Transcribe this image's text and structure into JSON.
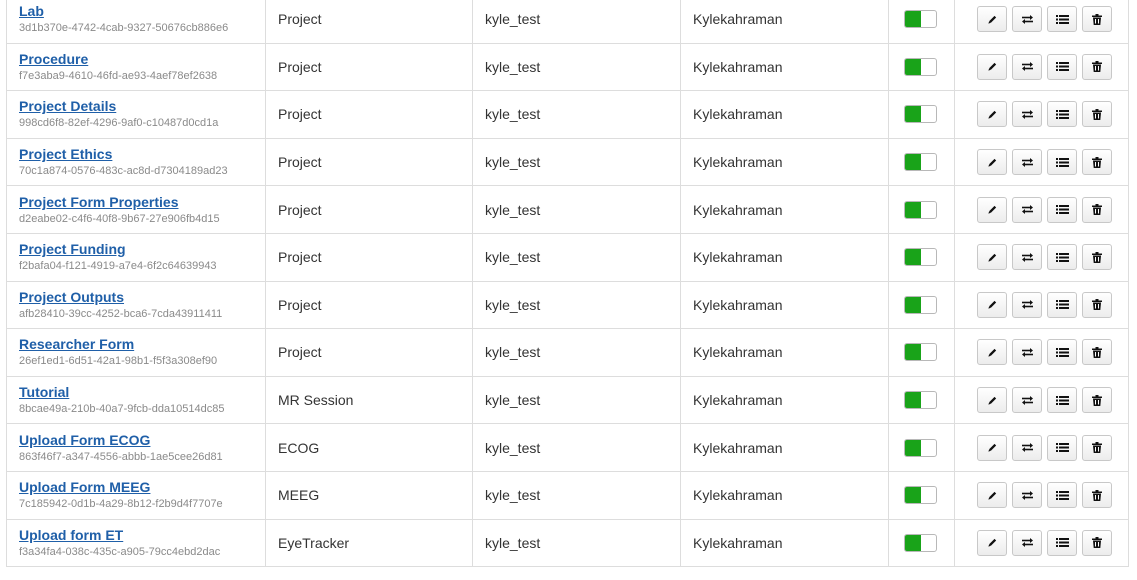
{
  "accent_colors": {
    "link": "#1f5fa8",
    "toggle_on": "#19a319"
  },
  "action_icons": [
    "pencil-icon",
    "swap-arrows-icon",
    "list-icon",
    "trash-icon"
  ],
  "rows": [
    {
      "name": "Lab",
      "id": "3d1b370e-4742-4cab-9327-50676cb886e6",
      "type": "Project",
      "project": "kyle_test",
      "owner": "Kylekahraman",
      "enabled": true
    },
    {
      "name": "Procedure",
      "id": "f7e3aba9-4610-46fd-ae93-4aef78ef2638",
      "type": "Project",
      "project": "kyle_test",
      "owner": "Kylekahraman",
      "enabled": true
    },
    {
      "name": "Project Details",
      "id": "998cd6f8-82ef-4296-9af0-c10487d0cd1a",
      "type": "Project",
      "project": "kyle_test",
      "owner": "Kylekahraman",
      "enabled": true
    },
    {
      "name": "Project Ethics",
      "id": "70c1a874-0576-483c-ac8d-d7304189ad23",
      "type": "Project",
      "project": "kyle_test",
      "owner": "Kylekahraman",
      "enabled": true
    },
    {
      "name": "Project Form Properties",
      "id": "d2eabe02-c4f6-40f8-9b67-27e906fb4d15",
      "type": "Project",
      "project": "kyle_test",
      "owner": "Kylekahraman",
      "enabled": true
    },
    {
      "name": "Project Funding",
      "id": "f2bafa04-f121-4919-a7e4-6f2c64639943",
      "type": "Project",
      "project": "kyle_test",
      "owner": "Kylekahraman",
      "enabled": true
    },
    {
      "name": "Project Outputs",
      "id": "afb28410-39cc-4252-bca6-7cda43911411",
      "type": "Project",
      "project": "kyle_test",
      "owner": "Kylekahraman",
      "enabled": true
    },
    {
      "name": "Researcher Form",
      "id": "26ef1ed1-6d51-42a1-98b1-f5f3a308ef90",
      "type": "Project",
      "project": "kyle_test",
      "owner": "Kylekahraman",
      "enabled": true
    },
    {
      "name": "Tutorial",
      "id": "8bcae49a-210b-40a7-9fcb-dda10514dc85",
      "type": "MR Session",
      "project": "kyle_test",
      "owner": "Kylekahraman",
      "enabled": true
    },
    {
      "name": "Upload Form ECOG",
      "id": "863f46f7-a347-4556-abbb-1ae5cee26d81",
      "type": "ECOG",
      "project": "kyle_test",
      "owner": "Kylekahraman",
      "enabled": true
    },
    {
      "name": "Upload Form MEEG",
      "id": "7c185942-0d1b-4a29-8b12-f2b9d4f7707e",
      "type": "MEEG",
      "project": "kyle_test",
      "owner": "Kylekahraman",
      "enabled": true
    },
    {
      "name": "Upload form ET",
      "id": "f3a34fa4-038c-435c-a905-79cc4ebd2dac",
      "type": "EyeTracker",
      "project": "kyle_test",
      "owner": "Kylekahraman",
      "enabled": true
    }
  ]
}
